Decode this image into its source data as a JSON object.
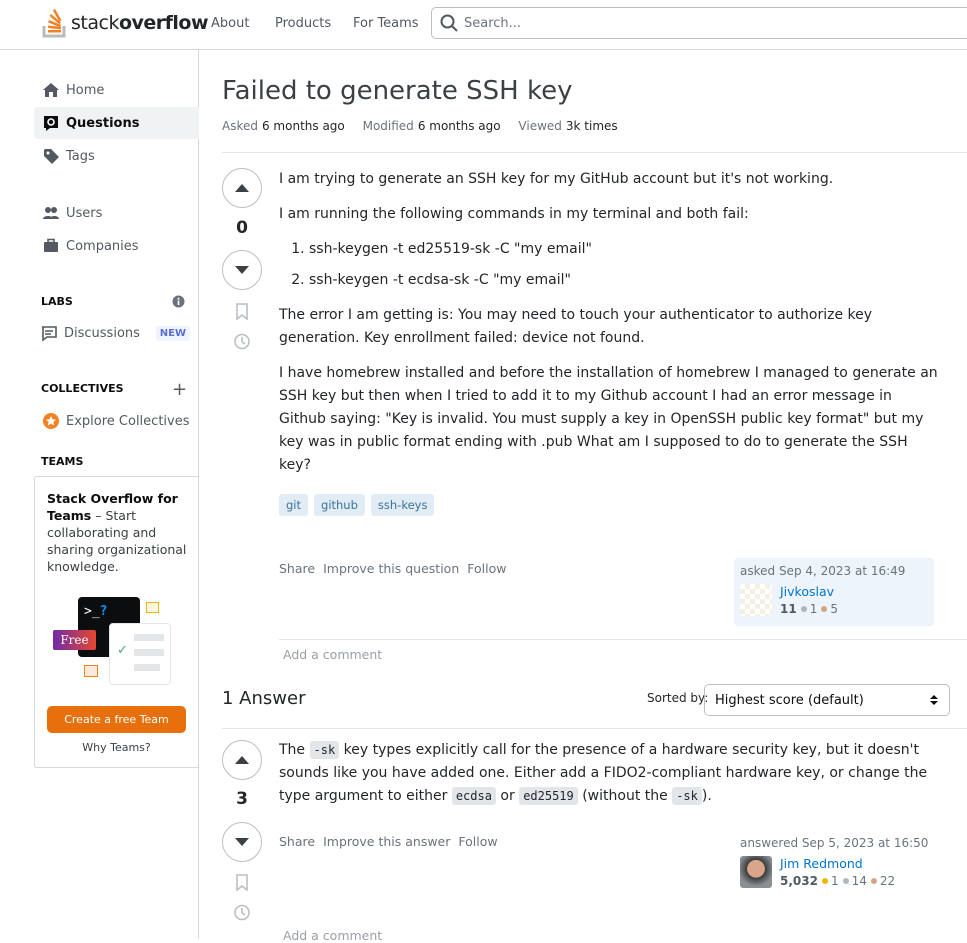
{
  "topbar": {
    "logo": {
      "light": "stack",
      "bold": "overflow"
    },
    "nav": [
      "About",
      "Products",
      "For Teams"
    ],
    "search_placeholder": "Search..."
  },
  "sidebar": {
    "items": [
      {
        "label": "Home",
        "icon": "home-icon"
      },
      {
        "label": "Questions",
        "icon": "questions-icon",
        "active": true
      },
      {
        "label": "Tags",
        "icon": "tag-icon"
      },
      {
        "label": "Users",
        "icon": "users-icon"
      },
      {
        "label": "Companies",
        "icon": "briefcase-icon"
      }
    ],
    "labs_heading": "LABS",
    "discussions": "Discussions",
    "new_badge": "NEW",
    "collectives_heading": "COLLECTIVES",
    "explore_collectives": "Explore Collectives",
    "teams_heading": "TEAMS",
    "teams_box": {
      "title": "Stack Overflow for Teams",
      "text": " – Start collaborating and sharing organizational knowledge.",
      "free_badge": "Free",
      "prompt_glyph": ">_",
      "question_glyph": "?",
      "cta": "Create a free Team",
      "why": "Why Teams?"
    }
  },
  "question": {
    "title": "Failed to generate SSH key",
    "meta": {
      "asked_label": "Asked",
      "asked": "6 months ago",
      "modified_label": "Modified",
      "modified": "6 months ago",
      "viewed_label": "Viewed",
      "viewed": "3k times"
    },
    "score": "0",
    "body": {
      "p1": "I am trying to generate an SSH key for my GitHub account but it's not working.",
      "p2": "I am running the following commands in my terminal and both fail:",
      "list": [
        "ssh-keygen -t ed25519-sk -C \"my email\"",
        "ssh-keygen -t ecdsa-sk -C \"my email\""
      ],
      "p3": "The error I am getting is: You may need to touch your authenticator to authorize key generation. Key enrollment failed: device not found.",
      "p4": "I have homebrew installed and before the installation of homebrew I managed to generate an SSH key but then when I tried to add it to my Github account I had an error message in Github saying: \"Key is invalid. You must supply a key in OpenSSH public key format\" but my key was in public format ending with .pub What am I supposed to do to generate the SSH key?"
    },
    "tags": [
      "git",
      "github",
      "ssh-keys"
    ],
    "actions": [
      "Share",
      "Improve this question",
      "Follow"
    ],
    "signature": {
      "action": "asked Sep 4, 2023 at 16:49",
      "user": "Jivkoslav",
      "reputation": "11",
      "silver": "1",
      "bronze": "5"
    },
    "add_comment": "Add a comment"
  },
  "answers": {
    "header": "1 Answer",
    "sorted_by_label": "Sorted by:",
    "sort_value": "Highest score (default)",
    "items": [
      {
        "score": "3",
        "body": {
          "t1": "The ",
          "c1": "-sk",
          "t2": " key types explicitly call for the presence of a hardware security key, but it doesn't sounds like you have added one. Either add a FIDO2-compliant hardware key, or change the type argument to either ",
          "c2": "ecdsa",
          "t3": " or ",
          "c3": "ed25519",
          "t4": " (without the ",
          "c4": "-sk",
          "t5": ")."
        },
        "actions": [
          "Share",
          "Improve this answer",
          "Follow"
        ],
        "signature": {
          "action": "answered Sep 5, 2023 at 16:50",
          "user": "Jim Redmond",
          "reputation": "5,032",
          "gold": "1",
          "silver": "14",
          "bronze": "22"
        },
        "add_comment": "Add a comment"
      }
    ]
  },
  "colors": {
    "accent": "#f48024",
    "cta": "#e7700d",
    "link": "#0074cc",
    "tag_bg": "#e1ecf4",
    "tag_fg": "#39739d",
    "signature_bg": "#edf4fb",
    "gold": "#f1b600",
    "silver": "#b1b7bc",
    "bronze": "#d1a684"
  }
}
